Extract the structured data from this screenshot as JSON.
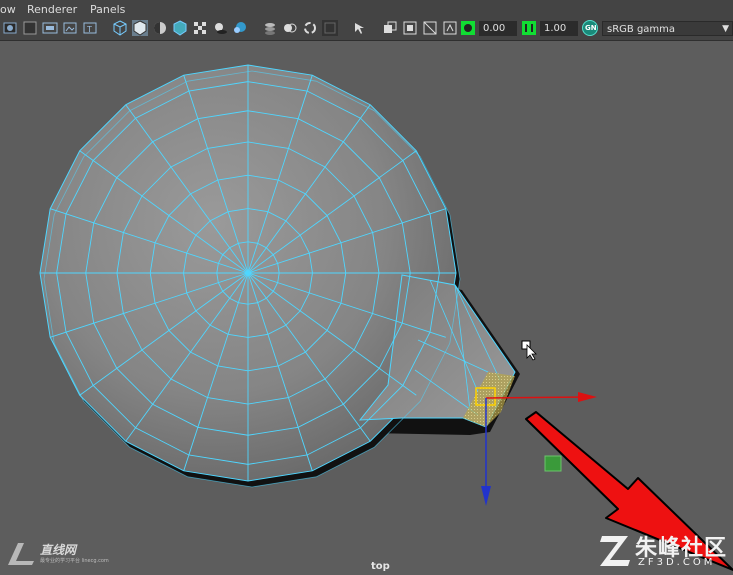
{
  "menu": [
    "ow",
    "Renderer",
    "Panels"
  ],
  "toolbar": {
    "exposure_value": "0.00",
    "gamma_value": "1.00",
    "color_space": "sRGB gamma",
    "color_mgmt_badge": "GN",
    "icons": [
      "select-camera-icon",
      "camera-attributes-icon",
      "bookmarks-icon",
      "image-plane-icon",
      "2d-pan-zoom-icon",
      "grease-pencil-icon",
      "wireframe-icon",
      "smooth-shade-icon",
      "wireframe-on-shaded-icon",
      "textured-icon",
      "use-all-lights-icon",
      "shadows-icon",
      "ambient-occlusion-icon",
      "motion-blur-icon",
      "anti-aliasing-icon",
      "isolate-select-icon",
      "xray-icon",
      "xray-active-components-icon",
      "xray-joints-icon",
      "resolution-gate-icon",
      "film-gate-icon",
      "gate-mask-icon",
      "field-chart-icon",
      "safe-action-icon",
      "exposure-icon",
      "gamma-icon",
      "color-management-icon"
    ]
  },
  "viewport": {
    "camera_label": "top",
    "mesh": "polygon-disc-with-spout",
    "selected_component": "face",
    "manipulator": "move-tool"
  },
  "watermarks": {
    "left_title": "直线网",
    "left_subtitle": "最专业的学习平台 linecg.com",
    "right_title": "朱峰社区",
    "right_sub": "ZF3D.COM"
  },
  "colors": {
    "background": "#5d5d5d",
    "wire": "#4fd6ff",
    "annotation_arrow": "#ee1111",
    "x_axis": "#dd1111",
    "y_axis": "#2233cc"
  }
}
